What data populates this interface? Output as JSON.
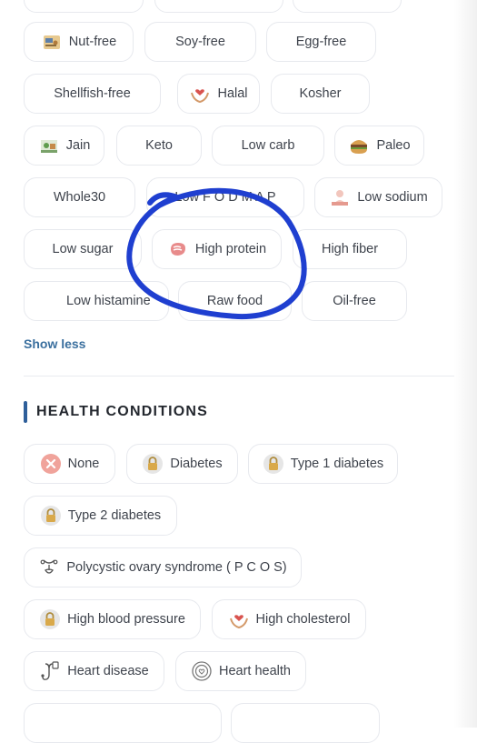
{
  "diet_chips": [
    {
      "label": "Nut-free",
      "icon": "nut-free-icon"
    },
    {
      "label": "Soy-free"
    },
    {
      "label": "Egg-free"
    },
    {
      "label": "Shellfish-free"
    },
    {
      "label": "Halal",
      "icon": "halal-icon"
    },
    {
      "label": "Kosher"
    },
    {
      "label": "Jain",
      "icon": "jain-icon"
    },
    {
      "label": "Keto"
    },
    {
      "label": "Low carb"
    },
    {
      "label": "Paleo",
      "icon": "paleo-icon"
    },
    {
      "label": "Whole30"
    },
    {
      "label": "Low F O D M A P"
    },
    {
      "label": "Low sodium",
      "icon": "low-sodium-icon"
    },
    {
      "label": "Low sugar"
    },
    {
      "label": "High protein",
      "icon": "high-protein-icon"
    },
    {
      "label": "High fiber"
    },
    {
      "label": "Low histamine"
    },
    {
      "label": "Raw food"
    },
    {
      "label": "Oil-free"
    }
  ],
  "show_less": "Show less",
  "health_section": {
    "title": "HEALTH CONDITIONS",
    "chips": [
      {
        "label": "None",
        "icon": "close-icon"
      },
      {
        "label": "Diabetes",
        "icon": "lock-icon"
      },
      {
        "label": "Type 1 diabetes",
        "icon": "lock-icon"
      },
      {
        "label": "Type 2 diabetes",
        "icon": "lock-icon"
      },
      {
        "label": "Polycystic ovary syndrome ( P C O S)",
        "icon": "ovary-icon"
      },
      {
        "label": "High blood pressure",
        "icon": "lock-icon"
      },
      {
        "label": "High cholesterol",
        "icon": "heart-hands-icon"
      },
      {
        "label": "Heart disease",
        "icon": "stethoscope-icon"
      },
      {
        "label": "Heart health",
        "icon": "heart-check-icon"
      }
    ]
  },
  "colors": {
    "accent": "#3a6f9e",
    "annotation": "#1f3fd0",
    "chip_border": "#e7e9ee"
  }
}
